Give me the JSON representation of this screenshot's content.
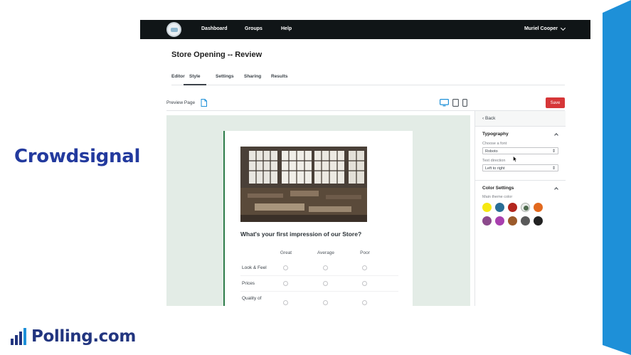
{
  "slide": {
    "brand_title": "Crowdsignal",
    "logo_text": "Polling.com",
    "accent_band_color": "#1e90d8"
  },
  "app": {
    "nav": {
      "items": [
        "Dashboard",
        "Groups",
        "Help"
      ],
      "user_name": "Muriel Cooper"
    },
    "page_title": "Store Opening -- Review",
    "tabs": [
      {
        "label": "Editor"
      },
      {
        "label": "Style",
        "active": true
      },
      {
        "label": "Settings"
      },
      {
        "label": "Sharing"
      },
      {
        "label": "Results"
      }
    ],
    "toolbar": {
      "preview_label": "Preview Page",
      "save_label": "Save"
    },
    "survey": {
      "question": "What's your first impression of our Store?",
      "columns": [
        "Great",
        "Average",
        "Poor"
      ],
      "rows": [
        "Look & Feel",
        "Prices",
        "Quality of"
      ]
    },
    "sidebar": {
      "back_label": "Back",
      "typography": {
        "title": "Typography",
        "font_label": "Choose a font",
        "font_value": "Roboto",
        "direction_label": "Text direction",
        "direction_value": "Left to right"
      },
      "color_settings": {
        "title": "Color Settings",
        "theme_label": "Main theme color",
        "swatches": [
          "#f6e812",
          "#2a6e96",
          "#b3261e",
          "#e9ece9",
          "#e2691e",
          "#8c4a8c",
          "#a83fae",
          "#9b5a2a",
          "#5a5a5a",
          "#222222"
        ],
        "selected_index": 3
      }
    }
  }
}
